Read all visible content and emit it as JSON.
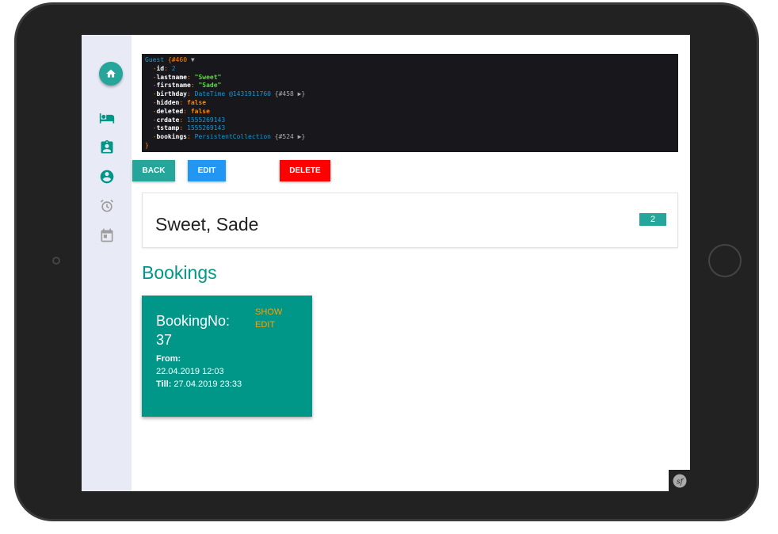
{
  "dump": {
    "class": "Guest",
    "ref": "{#460",
    "arrow": "▼",
    "fields": [
      {
        "key": "id",
        "value": "2",
        "type": "num"
      },
      {
        "key": "lastname",
        "value": "\"Sweet\"",
        "type": "str"
      },
      {
        "key": "firstname",
        "value": "\"Sade\"",
        "type": "str"
      },
      {
        "key": "birthday",
        "value": "DateTime @1431911760",
        "ref": "{#458 ▶}",
        "type": "obj"
      },
      {
        "key": "hidden",
        "value": "false",
        "type": "bool"
      },
      {
        "key": "deleted",
        "value": "false",
        "type": "bool"
      },
      {
        "key": "crdate",
        "value": "1555269143",
        "type": "num"
      },
      {
        "key": "tstamp",
        "value": "1555269143",
        "type": "num"
      },
      {
        "key": "bookings",
        "value": "PersistentCollection",
        "ref": "{#524 ▶}",
        "type": "obj"
      }
    ],
    "close": "}"
  },
  "buttons": {
    "back": "BACK",
    "edit": "EDIT",
    "delete": "DELETE"
  },
  "guest": {
    "name": "Sweet, Sade",
    "id_badge": "2"
  },
  "bookings": {
    "heading": "Bookings",
    "items": [
      {
        "title": "BookingNo:",
        "number": "37",
        "from_label": "From:",
        "from": "22.04.2019 12:03",
        "till_label": "Till:",
        "till": "27.04.2019 23:33",
        "show": "SHOW",
        "edit": "EDIT"
      }
    ]
  },
  "colors": {
    "primary": "#009688",
    "edit": "#2196f3",
    "delete": "#ff0000",
    "sidebar": "#e8eaf6"
  },
  "sidebar": {
    "icons": [
      "home-icon",
      "hotel-bed-icon",
      "badge-icon",
      "account-circle-icon",
      "alarm-icon",
      "calendar-icon"
    ]
  }
}
